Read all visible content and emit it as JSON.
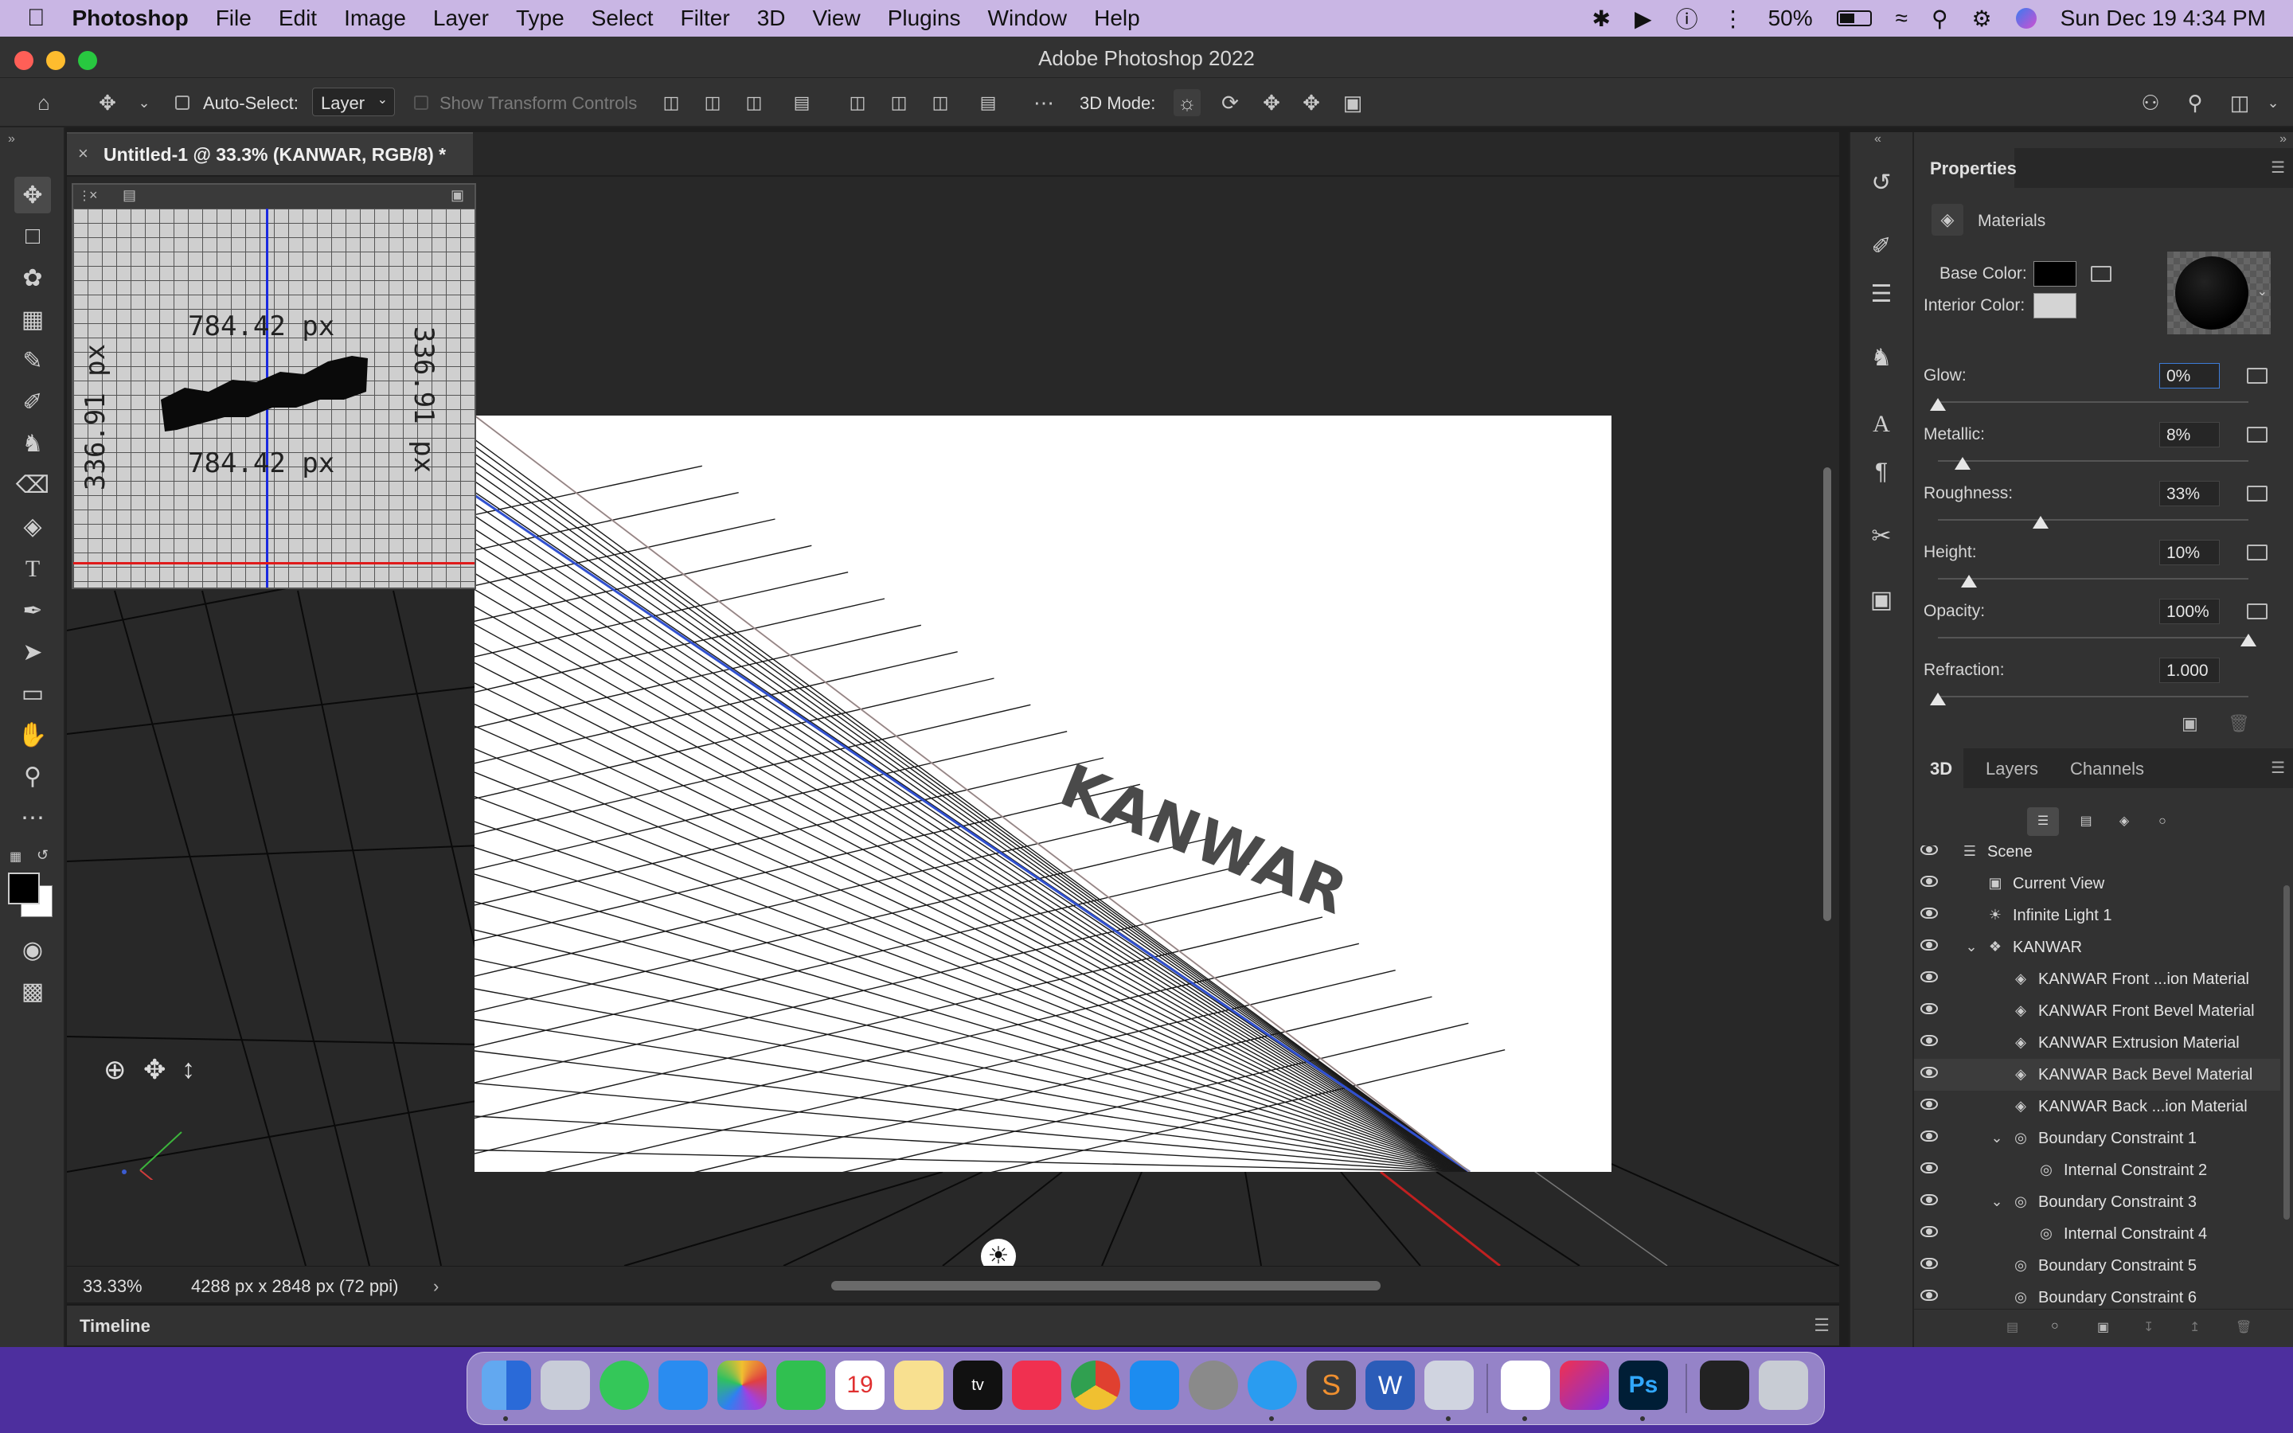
{
  "menubar": {
    "apple": "",
    "app_name": "Photoshop",
    "items": [
      "File",
      "Edit",
      "Image",
      "Layer",
      "Type",
      "Select",
      "Filter",
      "3D",
      "View",
      "Plugins",
      "Window",
      "Help"
    ],
    "battery": "50%",
    "datetime": "Sun Dec 19  4:34 PM"
  },
  "window": {
    "title": "Adobe Photoshop 2022"
  },
  "options": {
    "auto_select_label": "Auto-Select:",
    "auto_select_value": "Layer",
    "show_transform": "Show Transform Controls",
    "mode_label": "3D Mode:"
  },
  "document": {
    "tab_title": "Untitled-1 @ 33.3% (KANWAR, RGB/8) *",
    "text_3d": "KANWAR"
  },
  "navigator": {
    "width_label": "784.42 px",
    "width_label2": "784.42 px",
    "height_label": "336.91 px",
    "height_label2": "336.91 px"
  },
  "status": {
    "zoom": "33.33%",
    "size": "4288 px x 2848 px (72 ppi)"
  },
  "timeline": {
    "label": "Timeline"
  },
  "properties": {
    "title": "Properties",
    "section": "Materials",
    "base_color_label": "Base Color:",
    "interior_color_label": "Interior Color:",
    "base_color": "#000000",
    "interior_color": "#d4d4d4",
    "glow_label": "Glow:",
    "glow": "0%",
    "glow_pct": 0,
    "metallic_label": "Metallic:",
    "metallic": "8%",
    "metallic_pct": 8,
    "roughness_label": "Roughness:",
    "roughness": "33%",
    "roughness_pct": 33,
    "height_label": "Height:",
    "height": "10%",
    "height_pct": 10,
    "opacity_label": "Opacity:",
    "opacity": "100%",
    "opacity_pct": 100,
    "refraction_label": "Refraction:",
    "refraction": "1.000"
  },
  "panel3d": {
    "tabs": [
      "3D",
      "Layers",
      "Channels"
    ],
    "rows": [
      {
        "label": "Scene",
        "indent": 0,
        "icon": "scene-icon"
      },
      {
        "label": "Current View",
        "indent": 1,
        "icon": "camera-icon"
      },
      {
        "label": "Infinite Light 1",
        "indent": 1,
        "icon": "light-icon"
      },
      {
        "label": "KANWAR",
        "indent": 1,
        "icon": "mesh-icon"
      },
      {
        "label": "KANWAR Front ...ion Material",
        "indent": 2,
        "icon": "material-icon"
      },
      {
        "label": "KANWAR Front Bevel Material",
        "indent": 2,
        "icon": "material-icon"
      },
      {
        "label": "KANWAR Extrusion Material",
        "indent": 2,
        "icon": "material-icon"
      },
      {
        "label": "KANWAR Back Bevel Material",
        "indent": 2,
        "icon": "material-icon"
      },
      {
        "label": "KANWAR Back ...ion Material",
        "indent": 2,
        "icon": "material-icon"
      },
      {
        "label": "Boundary Constraint 1",
        "indent": 2,
        "icon": "constraint-icon"
      },
      {
        "label": "Internal Constraint 2",
        "indent": 3,
        "icon": "constraint-icon"
      },
      {
        "label": "Boundary Constraint 3",
        "indent": 2,
        "icon": "constraint-icon"
      },
      {
        "label": "Internal Constraint 4",
        "indent": 3,
        "icon": "constraint-icon"
      },
      {
        "label": "Boundary Constraint 5",
        "indent": 2,
        "icon": "constraint-icon"
      },
      {
        "label": "Boundary Constraint 6",
        "indent": 2,
        "icon": "constraint-icon"
      }
    ]
  }
}
